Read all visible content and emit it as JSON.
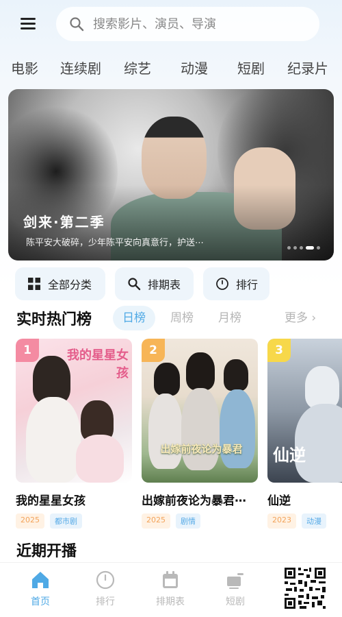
{
  "search": {
    "placeholder": "搜索影片、演员、导演"
  },
  "categories": [
    "电影",
    "连续剧",
    "综艺",
    "动漫",
    "短剧",
    "纪录片"
  ],
  "banner": {
    "title": "剑来·第二季",
    "subtitle": "陈平安大破碎，少年陈平安向真意行，护送⋯",
    "dots": 5,
    "active_dot": 4
  },
  "quick_actions": [
    {
      "label": "全部分类",
      "icon": "grid-icon"
    },
    {
      "label": "排期表",
      "icon": "search-icon"
    },
    {
      "label": "排行",
      "icon": "clock-icon"
    }
  ],
  "hot": {
    "title": "实时热门榜",
    "tabs": [
      "日榜",
      "周榜",
      "月榜"
    ],
    "active_tab": "日榜",
    "more": "更多",
    "items": [
      {
        "rank": "1",
        "title": "我的星星女孩",
        "year": "2025",
        "genre": "都市剧",
        "poster_text": "我的星星女孩"
      },
      {
        "rank": "2",
        "title": "出嫁前夜论为暴君⋯",
        "year": "2025",
        "genre": "剧情",
        "poster_text": "出嫁前夜论为暴君"
      },
      {
        "rank": "3",
        "title": "仙逆",
        "year": "2023",
        "genre": "动漫",
        "poster_text": "仙逆"
      }
    ]
  },
  "recent": {
    "title": "近期开播"
  },
  "bottom_nav": [
    {
      "label": "首页",
      "icon": "home-icon",
      "active": true
    },
    {
      "label": "排行",
      "icon": "clock-icon",
      "active": false
    },
    {
      "label": "排期表",
      "icon": "calendar-icon",
      "active": false
    },
    {
      "label": "短剧",
      "icon": "short-drama-icon",
      "active": false
    }
  ],
  "colors": {
    "accent": "#4fa9e5",
    "rank1": "#f48ba2",
    "rank2": "#f7b557",
    "rank3": "#f7d84a"
  }
}
